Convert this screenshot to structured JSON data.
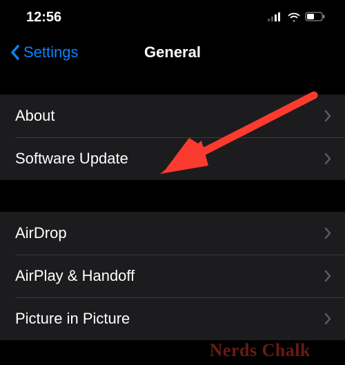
{
  "status_bar": {
    "time": "12:56"
  },
  "nav": {
    "back_label": "Settings",
    "title": "General"
  },
  "groups": [
    {
      "items": [
        {
          "label": "About"
        },
        {
          "label": "Software Update"
        }
      ]
    },
    {
      "items": [
        {
          "label": "AirDrop"
        },
        {
          "label": "AirPlay & Handoff"
        },
        {
          "label": "Picture in Picture"
        }
      ]
    }
  ],
  "watermark": "Nerds Chalk",
  "colors": {
    "accent": "#0a84ff",
    "row_bg": "#1c1c1e",
    "arrow": "#fb3b2f"
  }
}
